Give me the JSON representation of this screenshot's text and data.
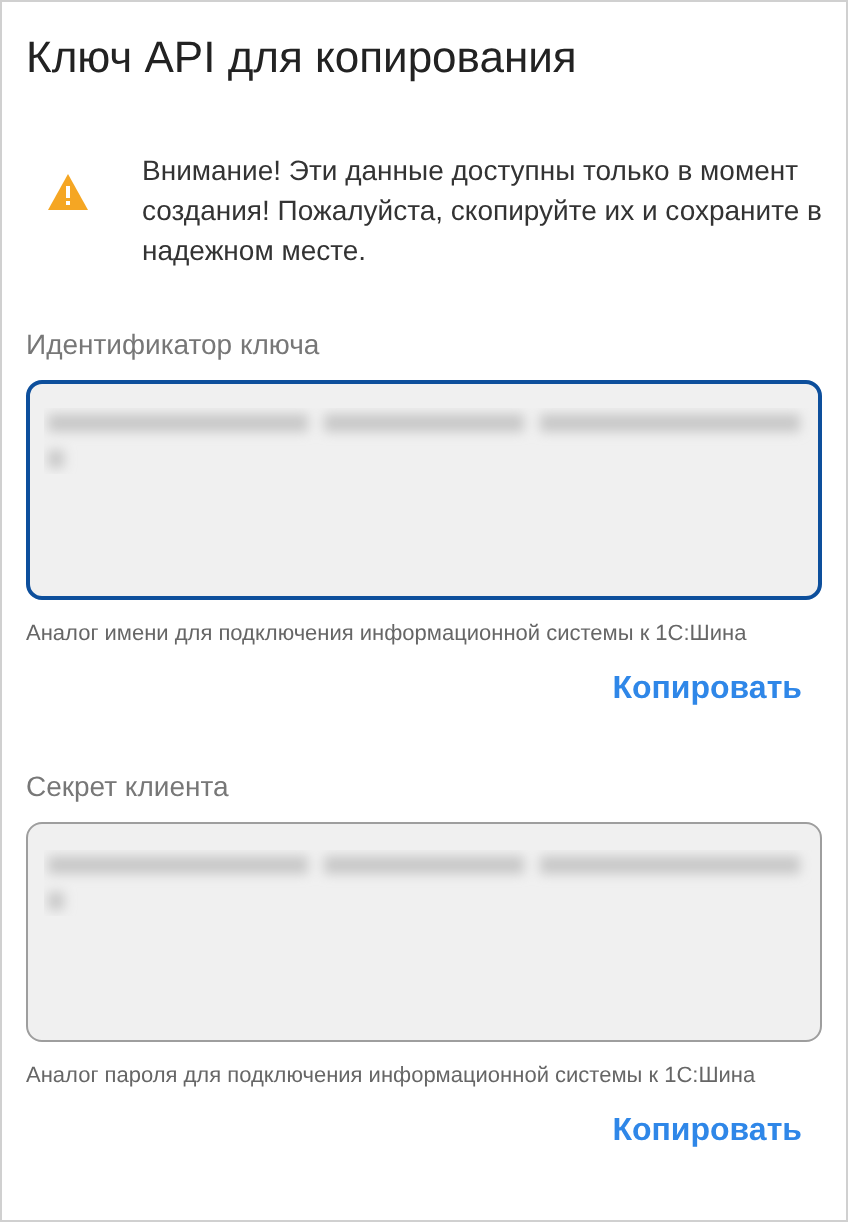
{
  "title": "Ключ API для копирования",
  "warning": {
    "text": "Внимание! Эти данные доступны только в момент создания! Пожалуйста, скопируйте их и сохраните в надежном месте."
  },
  "fields": [
    {
      "label": "Идентификатор ключа",
      "focused": true,
      "hint": "Аналог имени для подключения информационной системы к 1С:Шина",
      "button": "Копировать"
    },
    {
      "label": "Секрет клиента",
      "focused": false,
      "hint": "Аналог пароля для подключения информационной системы к 1С:Шина",
      "button": "Копировать"
    }
  ]
}
